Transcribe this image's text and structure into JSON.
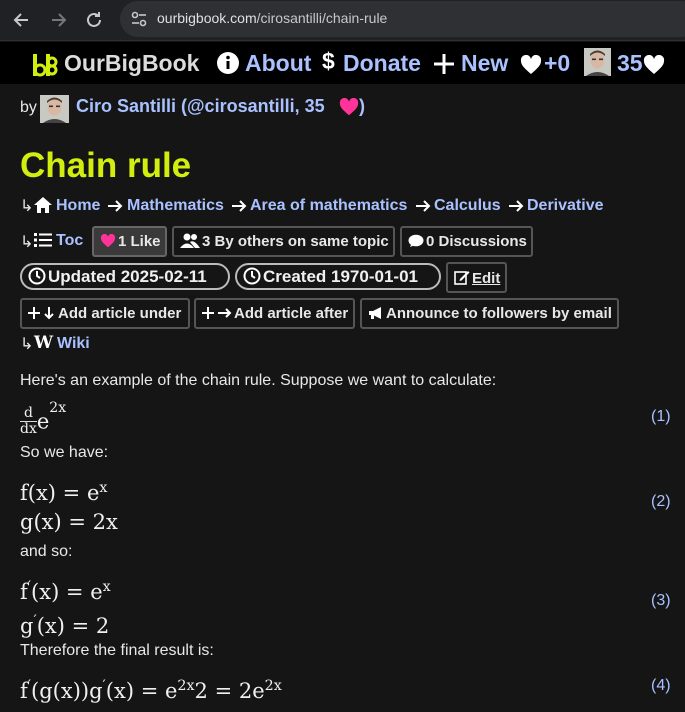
{
  "browser": {
    "url_host": "ourbigbook.com",
    "url_path": "/cirosantilli/chain-rule"
  },
  "site": {
    "brand": "OurBigBook",
    "about": "About",
    "donate_symbol": "$",
    "donate": "Donate",
    "new": "New",
    "likes": "+0",
    "score": "35"
  },
  "author": {
    "by": "by",
    "name": "Ciro Santilli (@cirosantilli, 35",
    "close": ")"
  },
  "article": {
    "title": "Chain rule",
    "breadcrumb": [
      "Home",
      "Mathematics",
      "Area of mathematics",
      "Calculus",
      "Derivative"
    ],
    "toc": "Toc",
    "like_button": "1 Like",
    "others_button": "3 By others on same topic",
    "discussions_button": "0 Discussions",
    "updated": "Updated 2025-02-11",
    "created": "Created 1970-01-01",
    "edit": "Edit",
    "add_under": "Add article under",
    "add_after": "Add article after",
    "announce": "Announce to followers by email",
    "wiki": "Wiki"
  },
  "content": {
    "intro": "Here's an example of the chain rule. Suppose we want to calculate:",
    "so_we_have": "So we have:",
    "and_so": "and so:",
    "therefore": "Therefore the final result is:",
    "eq_numbers": [
      "(1)",
      "(2)",
      "(3)",
      "(4)"
    ],
    "eq1": {
      "num": "d",
      "den": "dx",
      "base": "e",
      "exp": "2x"
    },
    "eq2": {
      "line1_lhs": "f(x) = e",
      "line1_exp": "x",
      "line2": "g(x) = 2x"
    },
    "eq3": {
      "line1_f": "f",
      "line1_prime": "′",
      "line1_rest": "(x) = e",
      "line1_exp": "x",
      "line2_g": "g",
      "line2_prime": "′",
      "line2_rest": "(x) = 2"
    },
    "eq4": {
      "f": "f",
      "p1": "′",
      "mid": "(g(x))g",
      "p2": "′",
      "rest1": "(x) = e",
      "exp1": "2x",
      "rest2": "2 = 2e",
      "exp2": "2x"
    }
  },
  "colors": {
    "background": "#151515",
    "link": "#a9c1ff",
    "title": "#d2ee0f",
    "heart": "#ff3399"
  },
  "icons": {
    "back": "arrow-left-icon",
    "forward": "arrow-right-icon",
    "reload": "reload-icon",
    "site_info": "tune-icon",
    "home": "home-icon",
    "toc": "list-icon",
    "like": "heart-icon",
    "others": "users-icon",
    "discussions": "comment-icon",
    "clock": "clock-icon",
    "edit": "edit-icon",
    "announce": "megaphone-icon",
    "wiki": "wikipedia-icon"
  }
}
